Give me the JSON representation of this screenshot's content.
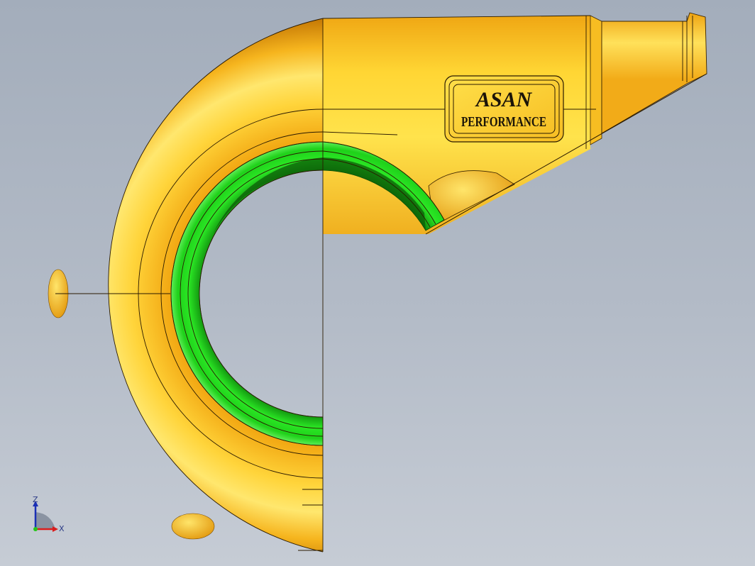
{
  "logo": {
    "line1": "ASAN",
    "line2": "PERFORMANCE"
  },
  "triad": {
    "z_label": "Z",
    "x_label": "X"
  },
  "colors": {
    "background_top": "#a3adbb",
    "background_bottom": "#c6ccd5",
    "housing": "#f5b21a",
    "housing_highlight": "#ffe46a",
    "housing_shadow": "#c57a06",
    "impeller_ring": "#22e01c",
    "impeller_dark": "#0c6e09",
    "edge_lines": "#2a1a00",
    "axis_z": "#1a2fb5",
    "axis_x": "#d91d1d"
  }
}
